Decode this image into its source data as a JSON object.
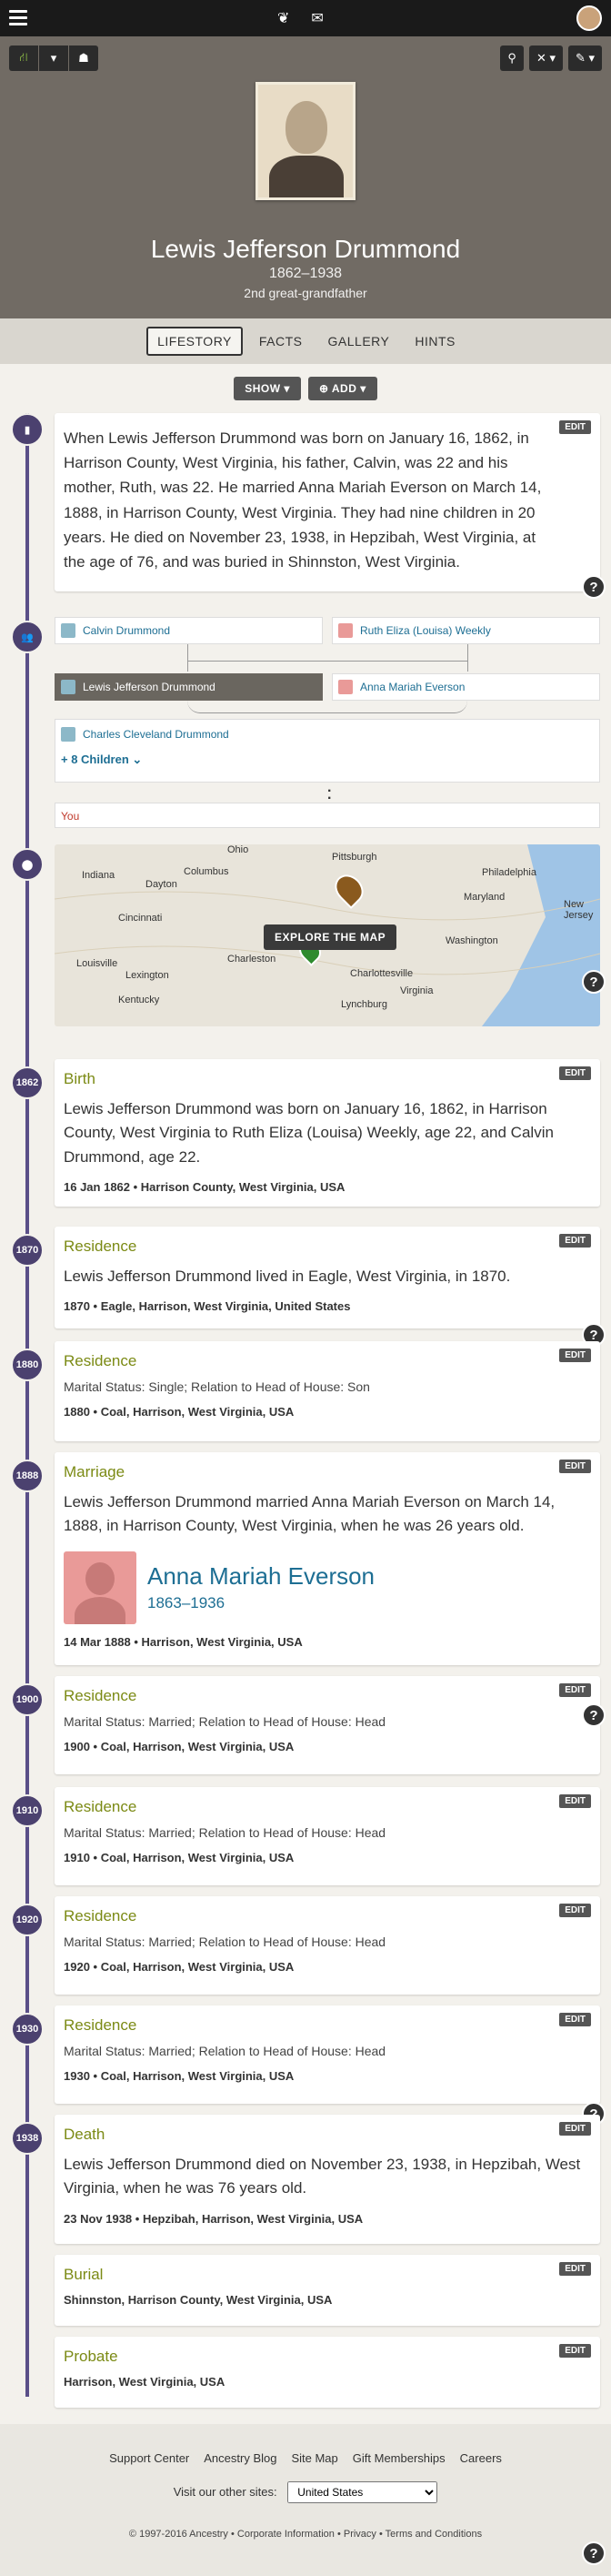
{
  "header": {
    "menu_icon": "hamburger-icon",
    "center_icons": [
      "leaf-icon",
      "envelope-icon"
    ]
  },
  "toolbar": {
    "left": [
      "tree-icon",
      "chevron-down-icon",
      "person-view-icon"
    ],
    "right": [
      "search-icon",
      "tools-icon",
      "edit-icon"
    ]
  },
  "person": {
    "name": "Lewis Jefferson Drummond",
    "dates": "1862–1938",
    "relationship": "2nd great-grandfather"
  },
  "tabs": [
    "LIFESTORY",
    "FACTS",
    "GALLERY",
    "HINTS"
  ],
  "actions": {
    "show_label": "SHOW",
    "add_label": "ADD"
  },
  "edit_label": "EDIT",
  "story": "When Lewis Jefferson Drummond was born on January 16, 1862, in Harrison County, West Virginia, his father, Calvin, was 22 and his mother, Ruth, was 22. He married Anna Mariah Everson on March 14, 1888, in Harrison County, West Virginia. They had nine children in 20 years. He died on November 23, 1938, in Hepzibah, West Virginia, at the age of 76, and was buried in Shinnston, West Virginia.",
  "family": {
    "father": "Calvin Drummond",
    "mother": "Ruth Eliza (Louisa) Weekly",
    "self": "Lewis Jefferson Drummond",
    "spouse": "Anna Mariah Everson",
    "child": "Charles Cleveland Drummond",
    "more_children": "+ 8 Children",
    "you": "You"
  },
  "map": {
    "button": "EXPLORE THE MAP",
    "labels": [
      "Ohio",
      "Pittsburgh",
      "Indiana",
      "Columbus",
      "Dayton",
      "Philadelphia",
      "Maryland",
      "Cincinnati",
      "Washington",
      "Louisville",
      "Lexington",
      "Charleston",
      "Charlottesville",
      "Virginia",
      "Kentucky",
      "Lynchburg",
      "New Jersey"
    ]
  },
  "events": [
    {
      "year": "1862",
      "title": "Birth",
      "text": "Lewis Jefferson Drummond was born on January 16, 1862, in Harrison County, West Virginia to Ruth Eliza (Louisa) Weekly, age 22, and Calvin Drummond, age 22.",
      "meta": "16 Jan 1862 • Harrison County, West Virginia, USA"
    },
    {
      "year": "1870",
      "title": "Residence",
      "text": "Lewis Jefferson Drummond lived in Eagle, West Virginia, in 1870.",
      "meta": "1870 • Eagle, Harrison, West Virginia, United States"
    },
    {
      "year": "1880",
      "title": "Residence",
      "sub": "Marital Status: Single; Relation to Head of House: Son",
      "meta": "1880 • Coal, Harrison, West Virginia, USA"
    },
    {
      "year": "1888",
      "title": "Marriage",
      "text": "Lewis Jefferson Drummond married Anna Mariah Everson on March 14, 1888, in Harrison County, West Virginia, when he was 26 years old.",
      "spouse_name": "Anna Mariah Everson",
      "spouse_dates": "1863–1936",
      "meta": "14 Mar 1888 • Harrison, West Virginia, USA"
    },
    {
      "year": "1900",
      "title": "Residence",
      "sub": "Marital Status: Married; Relation to Head of House: Head",
      "meta": "1900 • Coal, Harrison, West Virginia, USA"
    },
    {
      "year": "1910",
      "title": "Residence",
      "sub": "Marital Status: Married; Relation to Head of House: Head",
      "meta": "1910 • Coal, Harrison, West Virginia, USA"
    },
    {
      "year": "1920",
      "title": "Residence",
      "sub": "Marital Status: Married; Relation to Head of House: Head",
      "meta": "1920 • Coal, Harrison, West Virginia, USA"
    },
    {
      "year": "1930",
      "title": "Residence",
      "sub": "Marital Status: Married; Relation to Head of House: Head",
      "meta": "1930 • Coal, Harrison, West Virginia, USA"
    },
    {
      "year": "1938",
      "title": "Death",
      "text": "Lewis Jefferson Drummond died on November 23, 1938, in Hepzibah, West Virginia, when he was 76 years old.",
      "meta": "23 Nov 1938 • Hepzibah, Harrison, West Virginia, USA"
    },
    {
      "title": "Burial",
      "meta": "Shinnston, Harrison County, West Virginia, USA"
    },
    {
      "title": "Probate",
      "meta": "Harrison, West Virginia, USA"
    }
  ],
  "footer": {
    "links": [
      "Support Center",
      "Ancestry Blog",
      "Site Map",
      "Gift Memberships",
      "Careers"
    ],
    "visit_label": "Visit our other sites:",
    "site_selected": "United States",
    "copyright": "© 1997-2016 Ancestry • Corporate Information • Privacy • Terms and Conditions"
  },
  "colors": {
    "timeline": "#4b416f",
    "event_title": "#7b8a14",
    "link": "#1d6e93",
    "hero_bg": "#716b64"
  }
}
